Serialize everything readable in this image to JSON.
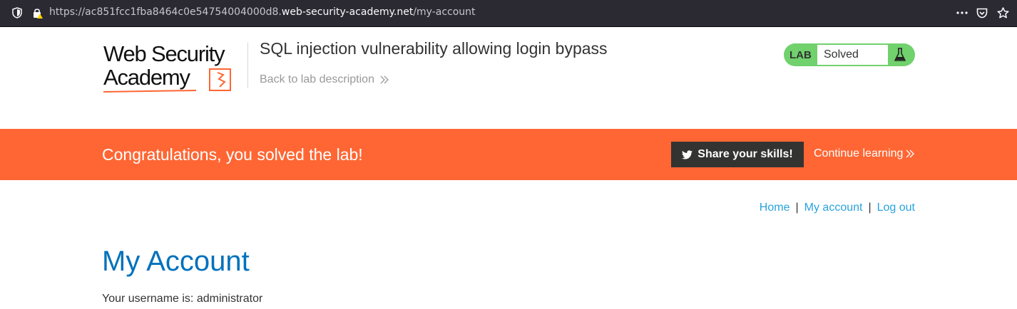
{
  "browser": {
    "url_prefix": "https://ac851fcc1fba8464c0e54754004000d8.",
    "url_host": "web-security-academy.net",
    "url_path": "/my-account",
    "icons": [
      "shield-icon",
      "warning-lock-icon",
      "more-icon",
      "pocket-icon",
      "bookmark-star-icon"
    ]
  },
  "header": {
    "logo_line1": "Web Security",
    "logo_line2": "Academy",
    "lab_title": "SQL injection vulnerability allowing login bypass",
    "back_link": "Back to lab description",
    "lab_tag": "LAB",
    "lab_status": "Solved"
  },
  "banner": {
    "message": "Congratulations, you solved the lab!",
    "share_label": "Share your skills!",
    "continue_label": "Continue learning"
  },
  "nav": {
    "home": "Home",
    "separator": "|",
    "my_account": "My account",
    "log_out": "Log out"
  },
  "main": {
    "title": "My Account",
    "username_text": "Your username is: administrator"
  },
  "colors": {
    "browser_bar": "#2b2a33",
    "banner": "#ff6633",
    "lab_solved": "#70d16d",
    "link": "#29a3dd",
    "heading": "#0071bc",
    "share_button": "#333332"
  }
}
